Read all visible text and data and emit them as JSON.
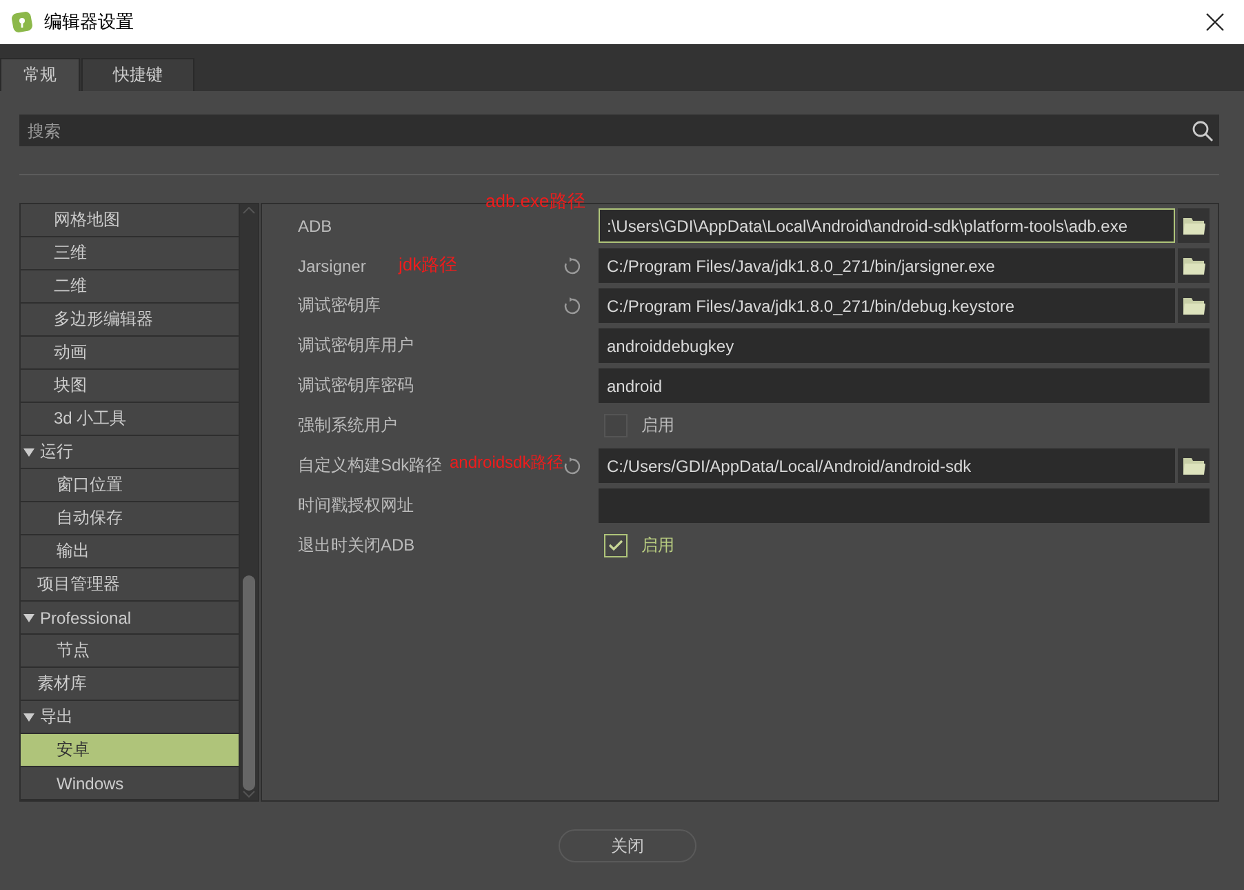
{
  "window": {
    "title": "编辑器设置"
  },
  "tabs": [
    {
      "label": "常规",
      "selected": true
    },
    {
      "label": "快捷键",
      "selected": false
    }
  ],
  "search": {
    "placeholder": "搜索"
  },
  "tree": {
    "continued_children": [
      {
        "label": "网格地图",
        "selected": false
      },
      {
        "label": "三维",
        "selected": false
      },
      {
        "label": "二维",
        "selected": false
      },
      {
        "label": "多边形编辑器",
        "selected": false
      },
      {
        "label": "动画",
        "selected": false
      },
      {
        "label": "块图",
        "selected": false
      },
      {
        "label": "3d 小工具",
        "selected": false
      }
    ],
    "items": [
      {
        "label": "运行",
        "selected": false,
        "expanded": true,
        "children": [
          {
            "label": "窗口位置",
            "selected": false
          },
          {
            "label": "自动保存",
            "selected": false
          },
          {
            "label": "输出",
            "selected": false
          }
        ]
      },
      {
        "label": "项目管理器",
        "selected": false
      },
      {
        "label": "Professional",
        "selected": false,
        "expanded": true,
        "children": [
          {
            "label": "节点",
            "selected": false
          }
        ]
      },
      {
        "label": "素材库",
        "selected": false
      },
      {
        "label": "导出",
        "selected": false,
        "expanded": true,
        "children": [
          {
            "label": "安卓",
            "selected": true
          },
          {
            "label": "Windows",
            "selected": false
          }
        ]
      }
    ]
  },
  "settings": [
    {
      "label": "ADB",
      "kind": "path",
      "value": ":\\Users\\GDI\\AppData\\Local\\Android\\android-sdk\\platform-tools\\adb.exe",
      "reset": false,
      "focused": true,
      "annotation": "adb.exe路径"
    },
    {
      "label": "Jarsigner",
      "kind": "path",
      "value": "C:/Program Files/Java/jdk1.8.0_271/bin/jarsigner.exe",
      "reset": true,
      "focused": false,
      "annotation": "jdk路径"
    },
    {
      "label": "调试密钥库",
      "kind": "path",
      "value": "C:/Program Files/Java/jdk1.8.0_271/bin/debug.keystore",
      "reset": true,
      "focused": false
    },
    {
      "label": "调试密钥库用户",
      "kind": "text",
      "value": "androiddebugkey",
      "reset": false,
      "focused": false
    },
    {
      "label": "调试密钥库密码",
      "kind": "text",
      "value": "android",
      "reset": false,
      "focused": false
    },
    {
      "label": "强制系统用户",
      "kind": "checkbox",
      "checked": false,
      "check_label": "启用",
      "reset": false
    },
    {
      "label": "自定义构建Sdk路径",
      "kind": "path",
      "value": "C:/Users/GDI/AppData/Local/Android/android-sdk",
      "reset": true,
      "focused": false,
      "annotation": "androidsdk路径"
    },
    {
      "label": "时间戳授权网址",
      "kind": "text",
      "reset": false,
      "focused": false
    },
    {
      "label": "退出时关闭ADB",
      "kind": "checkbox",
      "checked": true,
      "check_label": "启用",
      "reset": false
    }
  ],
  "buttons": [
    {
      "label": "关闭"
    }
  ]
}
